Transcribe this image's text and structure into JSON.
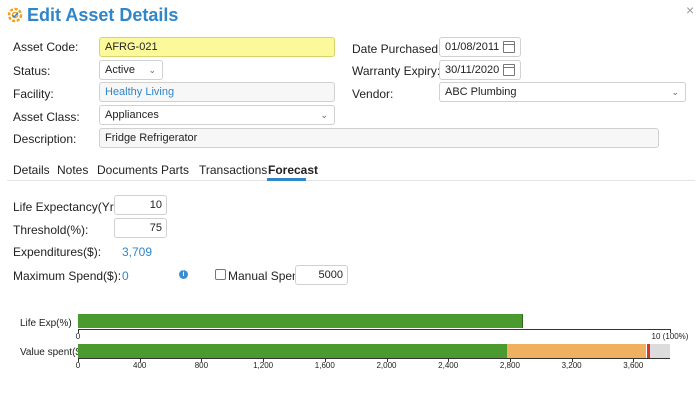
{
  "header": {
    "title": "Edit Asset Details",
    "icon": "gear-icon",
    "close_label": "×"
  },
  "form": {
    "asset_code": {
      "label": "Asset Code:",
      "value": "AFRG-021"
    },
    "status": {
      "label": "Status:",
      "value": "Active"
    },
    "facility": {
      "label": "Facility:",
      "value": "Healthy Living"
    },
    "asset_class": {
      "label": "Asset Class:",
      "value": "Appliances"
    },
    "description": {
      "label": "Description:",
      "value": "Fridge Refrigerator"
    },
    "date_purchased": {
      "label": "Date Purchased:",
      "value": "01/08/2011"
    },
    "warranty_expiry": {
      "label": "Warranty Expiry:",
      "value": "30/11/2020"
    },
    "vendor": {
      "label": "Vendor:",
      "value": "ABC Plumbing"
    }
  },
  "tabs": [
    {
      "label": "Details"
    },
    {
      "label": "Notes"
    },
    {
      "label": "Documents"
    },
    {
      "label": "Parts"
    },
    {
      "label": "Transactions"
    },
    {
      "label": "Forecast",
      "active": true
    }
  ],
  "forecast": {
    "life_expectancy": {
      "label": "Life Expectancy(Yrs):",
      "value": "10"
    },
    "threshold": {
      "label": "Threshold(%):",
      "value": "75"
    },
    "expenditures": {
      "label": "Expenditures($):",
      "value": "3,709"
    },
    "maximum_spend": {
      "label": "Maximum Spend($):",
      "value": "0"
    },
    "manual_spend": {
      "label": "Manual Spend:",
      "value": "5000",
      "checked": false
    }
  },
  "chart_data": [
    {
      "type": "bar",
      "orientation": "horizontal",
      "category": "Life Exp(%)",
      "xlim": [
        0,
        10
      ],
      "segments": [
        {
          "name": "elapsed",
          "value": 7.5,
          "color": "#4a9a2f"
        },
        {
          "name": "remaining",
          "value": 2.5,
          "color": "#efb15f"
        }
      ],
      "tick_labels": [
        {
          "value": 0,
          "label": "0"
        },
        {
          "value": 10,
          "label": "10 (100%)"
        }
      ]
    },
    {
      "type": "bar",
      "orientation": "horizontal",
      "category": "Value spent($)",
      "xlim": [
        0,
        4000
      ],
      "segments": [
        {
          "name": "threshold",
          "value": 2780,
          "color": "#4a9a2f"
        },
        {
          "name": "to-expenditure",
          "value": 3680,
          "color": "#efb15f"
        },
        {
          "name": "expenditure-marker",
          "value": 3709,
          "color": "#d9342b"
        },
        {
          "name": "max",
          "value": 4000,
          "color": "#dcdcdc"
        }
      ],
      "tick_labels": [
        {
          "value": 0,
          "label": "0"
        },
        {
          "value": 400,
          "label": "400"
        },
        {
          "value": 800,
          "label": "800"
        },
        {
          "value": 1200,
          "label": "1,200"
        },
        {
          "value": 1600,
          "label": "1,600"
        },
        {
          "value": 2000,
          "label": "2,000"
        },
        {
          "value": 2400,
          "label": "2,400"
        },
        {
          "value": 2800,
          "label": "2,800"
        },
        {
          "value": 3200,
          "label": "3,200"
        },
        {
          "value": 3600,
          "label": "3,600"
        }
      ]
    }
  ],
  "colors": {
    "accent": "#2f86c9",
    "code_highlight": "#fbf99a",
    "bar_green": "#4a9a2f",
    "bar_orange": "#efb15f",
    "bar_red": "#d9342b"
  }
}
